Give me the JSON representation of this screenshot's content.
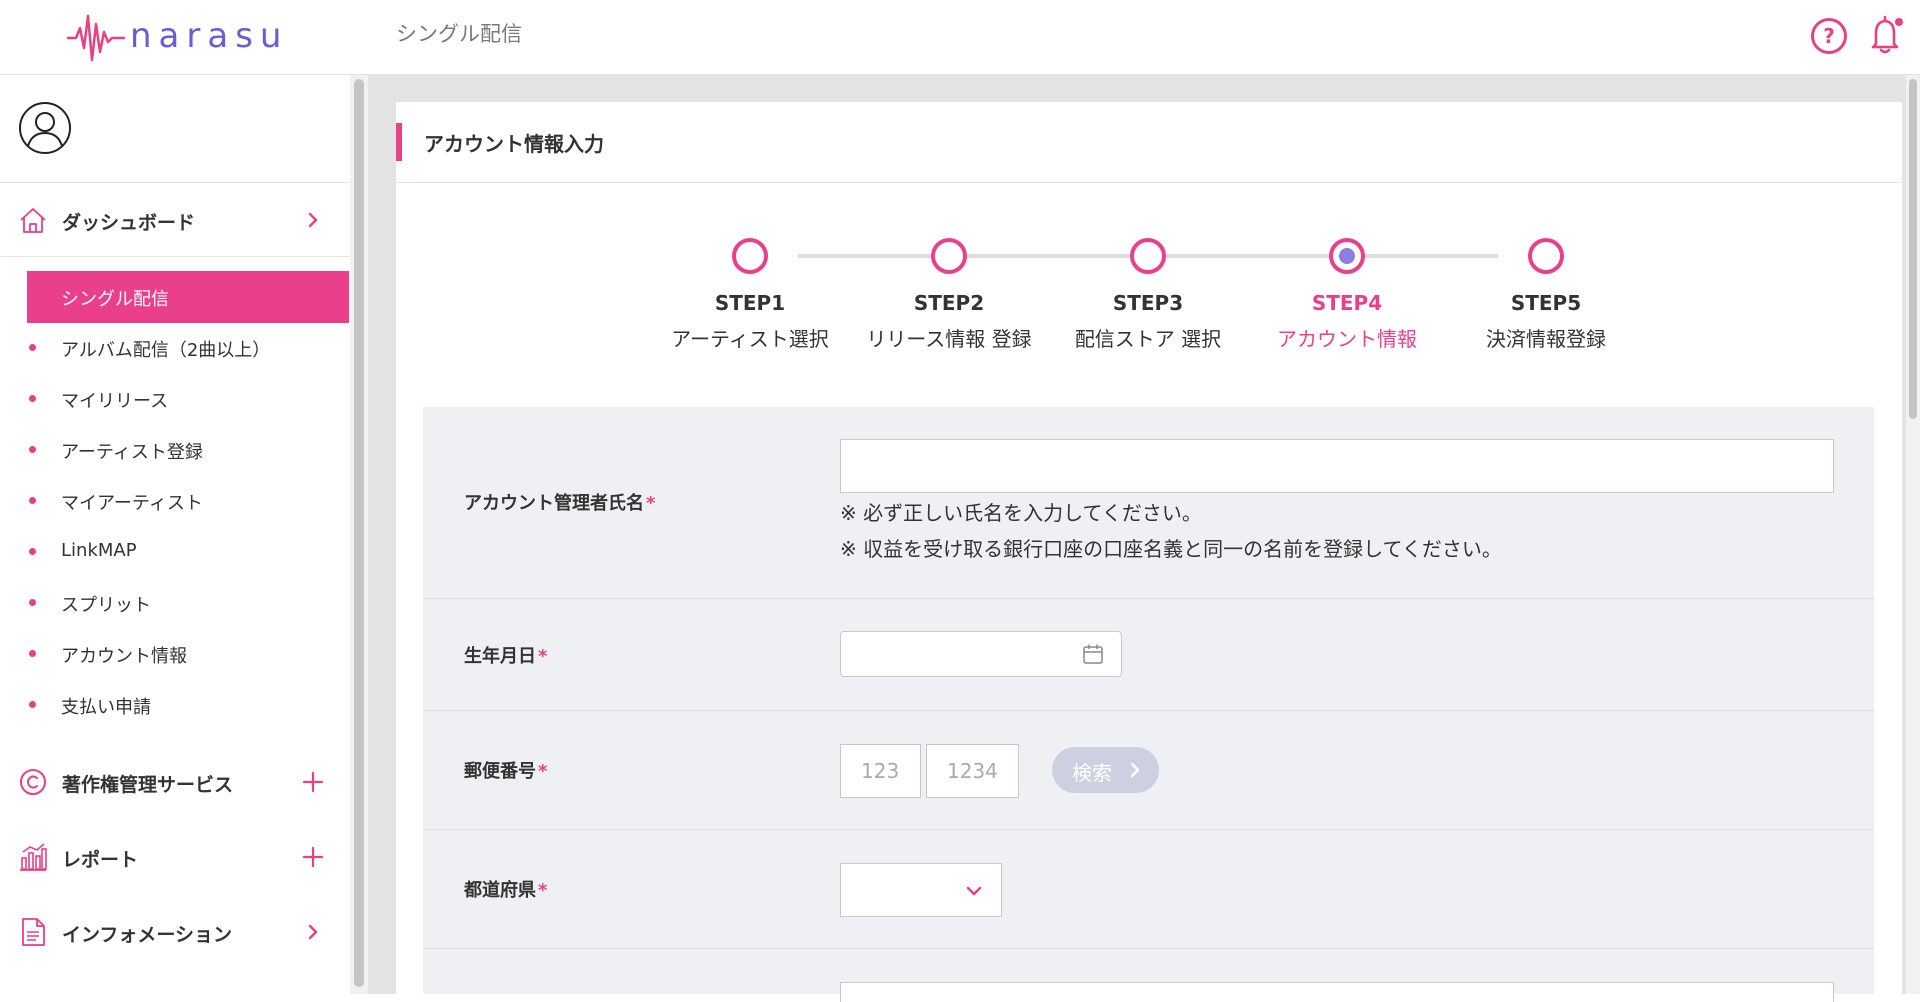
{
  "header": {
    "logo_text": "narasu",
    "title": "シングル配信",
    "help_icon": "question-circle-icon",
    "notification_icon": "bell-icon"
  },
  "sidebar": {
    "avatar_icon": "user-circle-icon",
    "dashboard": {
      "label": "ダッシュボード",
      "icon": "home-icon"
    },
    "active_item": "シングル配信",
    "items": [
      {
        "label": "アルバム配信（2曲以上）"
      },
      {
        "label": "マイリリース"
      },
      {
        "label": "アーティスト登録"
      },
      {
        "label": "マイアーティスト"
      },
      {
        "label": "LinkMAP"
      },
      {
        "label": "スプリット"
      },
      {
        "label": "アカウント情報"
      },
      {
        "label": "支払い申請"
      }
    ],
    "copyright": {
      "label": "著作権管理サービス",
      "icon": "copyright-icon"
    },
    "report": {
      "label": "レポート",
      "icon": "chart-icon"
    },
    "information": {
      "label": "インフォメーション",
      "icon": "document-icon"
    }
  },
  "card": {
    "title": "アカウント情報入力"
  },
  "stepper": {
    "current_step": 4,
    "steps": [
      {
        "number": "STEP1",
        "name": "アーティスト選択"
      },
      {
        "number": "STEP2",
        "name": "リリース情報 登録"
      },
      {
        "number": "STEP3",
        "name": "配信ストア 選択"
      },
      {
        "number": "STEP4",
        "name": "アカウント情報"
      },
      {
        "number": "STEP5",
        "name": "決済情報登録"
      }
    ]
  },
  "form": {
    "name": {
      "label": "アカウント管理者氏名",
      "required_mark": "*",
      "value": "",
      "notes": [
        "※ 必ず正しい氏名を入力してください。",
        "※ 収益を受け取る銀行口座の口座名義と同一の名前を登録してください。"
      ]
    },
    "birthday": {
      "label": "生年月日",
      "required_mark": "*",
      "value": "",
      "icon": "calendar-icon"
    },
    "postal": {
      "label": "郵便番号",
      "required_mark": "*",
      "placeholder1": "123",
      "placeholder2": "1234",
      "search_label": "検索"
    },
    "prefecture": {
      "label": "都道府県",
      "required_mark": "*",
      "value": "",
      "icon": "chevron-down-icon"
    }
  },
  "colors": {
    "accent": "#ea3f8a",
    "logo": "#6d5bd6",
    "current_step_fill": "#8a7ee0",
    "search_button": "#cdd0e0"
  }
}
